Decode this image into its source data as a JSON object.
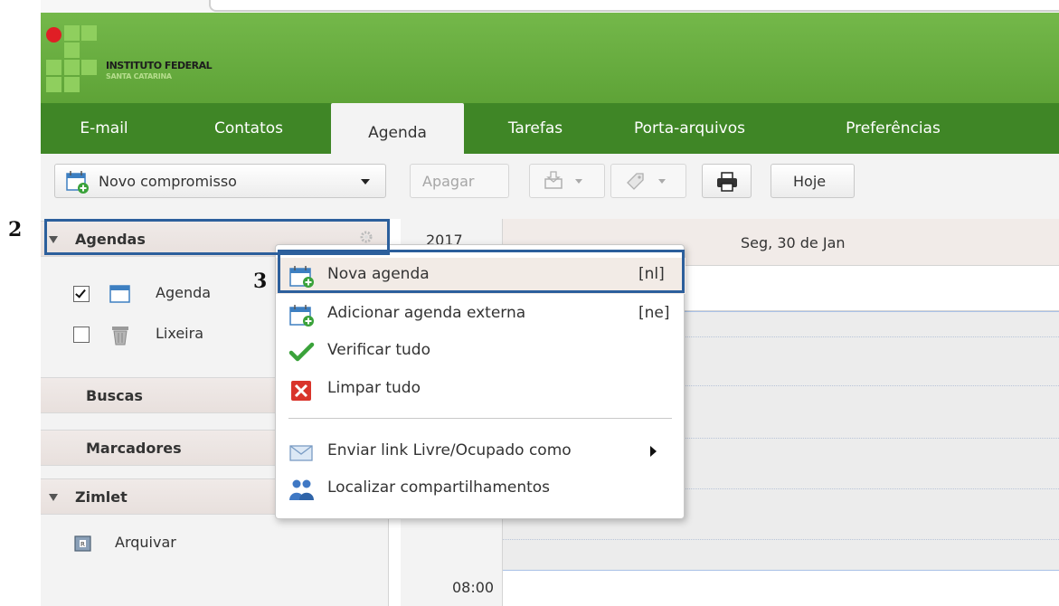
{
  "header": {
    "logo_line1": "INSTITUTO FEDERAL",
    "logo_line2": "SANTA CATARINA"
  },
  "tabs": [
    {
      "label": "E-mail"
    },
    {
      "label": "Contatos"
    },
    {
      "label": "Agenda"
    },
    {
      "label": "Tarefas"
    },
    {
      "label": "Porta-arquivos"
    },
    {
      "label": "Preferências"
    }
  ],
  "toolbar": {
    "new_appointment": "Novo compromisso",
    "delete": "Apagar",
    "today": "Hoje"
  },
  "sidebar": {
    "agendas_header": "Agendas",
    "calendars": [
      {
        "label": "Agenda",
        "checked": true
      },
      {
        "label": "Lixeira",
        "checked": false
      }
    ],
    "searches": "Buscas",
    "tags": "Marcadores",
    "zimlet_header": "Zimlet",
    "zimlet_item": "Arquivar"
  },
  "calendar": {
    "year": "2017",
    "day_header": "Seg, 30 de Jan",
    "time_label": "08:00"
  },
  "context_menu": {
    "items": [
      {
        "label": "Nova agenda",
        "shortcut": "[nl]"
      },
      {
        "label": "Adicionar agenda externa",
        "shortcut": "[ne]"
      },
      {
        "label": "Verificar tudo"
      },
      {
        "label": "Limpar tudo"
      },
      {
        "label": "Enviar link Livre/Ocupado como"
      },
      {
        "label": "Localizar compartilhamentos"
      }
    ]
  },
  "annotations": {
    "step2": "2",
    "step3": "3"
  },
  "colors": {
    "header_green": "#5ea337",
    "tabs_green": "#3f8626",
    "annotation_blue": "#2c5f9c",
    "menu_highlight": "#f2ebe6"
  }
}
